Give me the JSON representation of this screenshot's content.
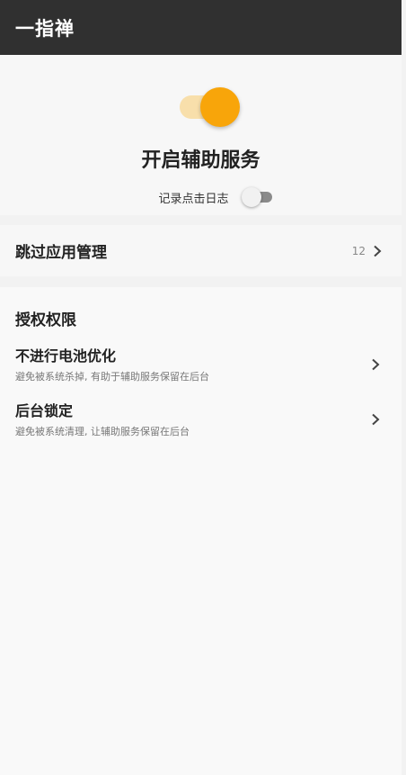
{
  "header": {
    "title": "一指禅"
  },
  "service": {
    "toggle_on": true,
    "title": "开启辅助服务",
    "log_label": "记录点击日志",
    "log_toggle_on": false
  },
  "skip": {
    "label": "跳过应用管理",
    "count": "12"
  },
  "permissions": {
    "title": "授权权限",
    "items": [
      {
        "title": "不进行电池优化",
        "desc": "避免被系统杀掉, 有助于辅助服务保留在后台"
      },
      {
        "title": "后台锁定",
        "desc": "避免被系统清理, 让辅助服务保留在后台"
      }
    ]
  },
  "colors": {
    "header_bg": "#303030",
    "accent": "#f8a50a",
    "accent_track": "#f8dfab",
    "page_bg": "#f2f2f2"
  },
  "icons": {
    "chevron": "chevron-right-icon"
  }
}
